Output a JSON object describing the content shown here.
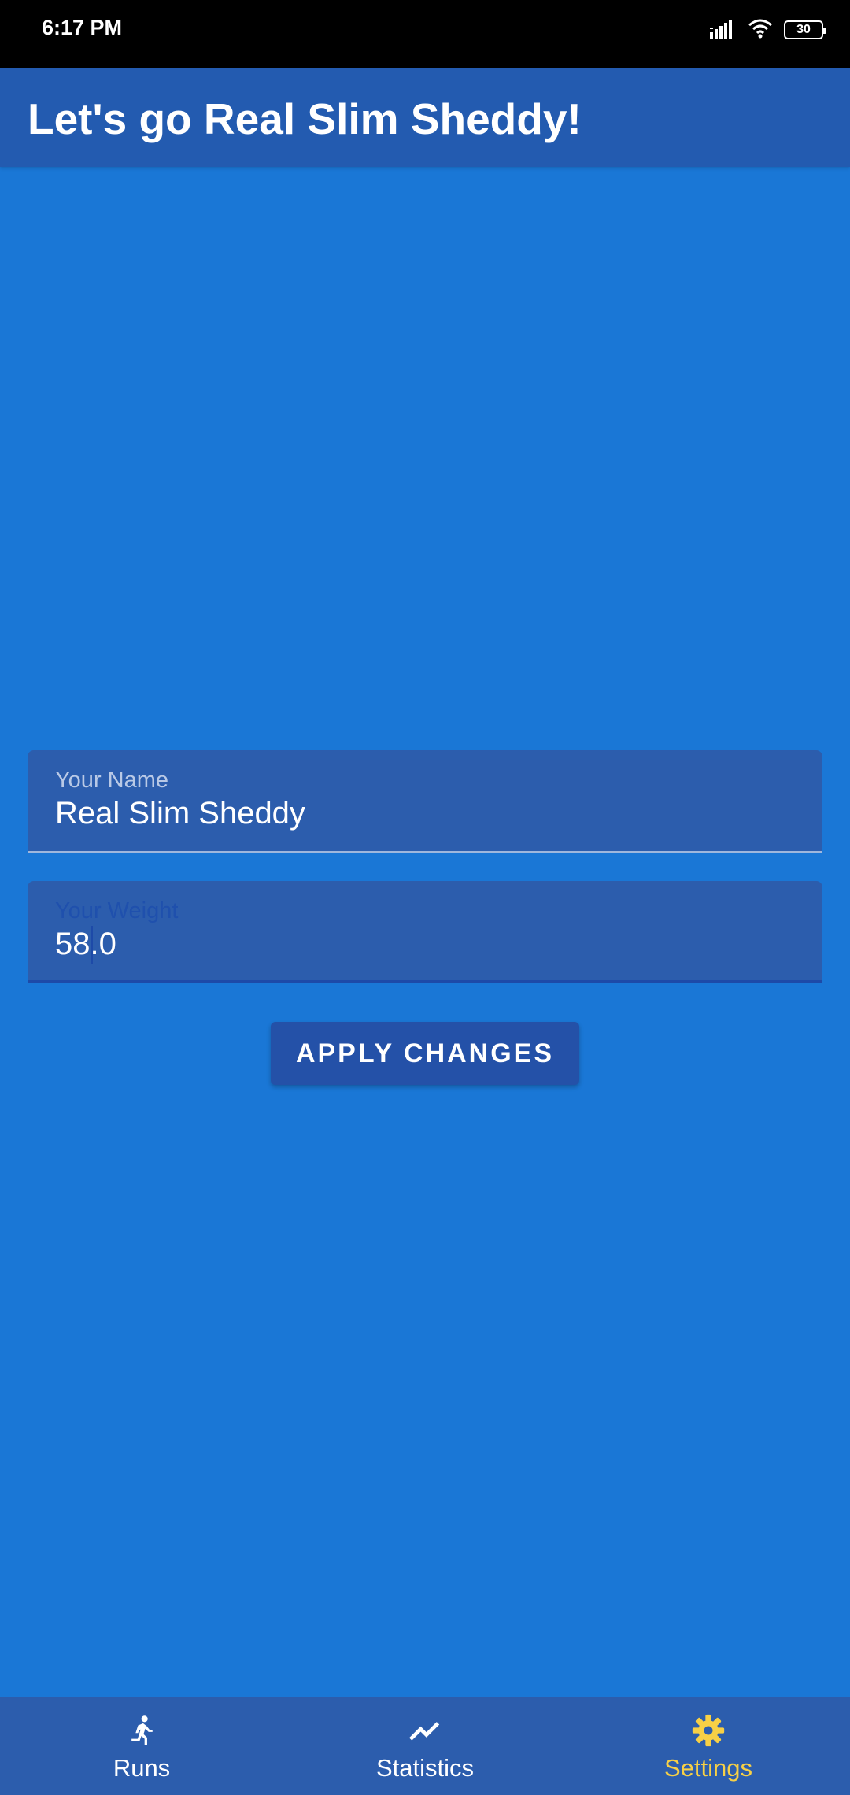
{
  "status_bar": {
    "time": "6:17 PM",
    "battery": "30",
    "icons": [
      "signal-icon",
      "wifi-icon",
      "battery-icon"
    ]
  },
  "app_bar": {
    "title": "Let's go Real Slim Sheddy!"
  },
  "form": {
    "name_field": {
      "label": "Your Name",
      "value": "Real Slim Sheddy"
    },
    "weight_field": {
      "label": "Your Weight",
      "value": "58.0"
    },
    "apply_label": "APPLY CHANGES"
  },
  "bottom_nav": {
    "items": [
      {
        "label": "Runs",
        "icon": "run-icon"
      },
      {
        "label": "Statistics",
        "icon": "trending-up-icon"
      },
      {
        "label": "Settings",
        "icon": "gear-icon",
        "selected": true
      }
    ]
  },
  "colors": {
    "background": "#1a77d6",
    "app_bar": "#235bb0",
    "field_background": "#2c5dad",
    "accent_selected": "#f7d046",
    "status_bar": "#000000"
  }
}
